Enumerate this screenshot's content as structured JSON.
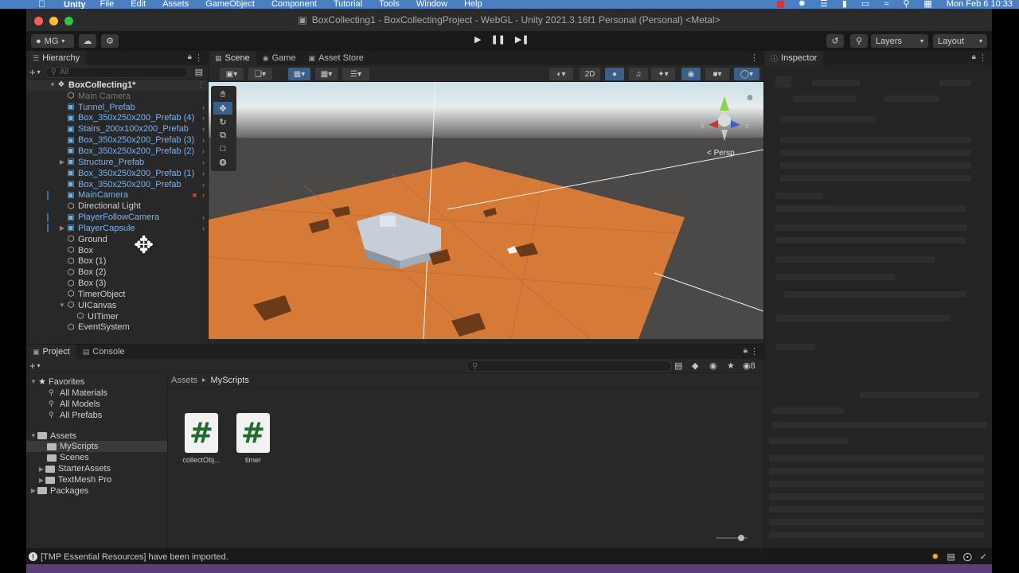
{
  "menubar": {
    "app": "Unity",
    "items": [
      "File",
      "Edit",
      "Assets",
      "GameObject",
      "Component",
      "Tutorial",
      "Tools",
      "Window",
      "Help"
    ],
    "clock": "Mon Feb 6  10:33"
  },
  "window": {
    "title": "BoxCollecting1 - BoxCollectingProject - WebGL - Unity 2021.3.16f1 Personal (Personal) <Metal>"
  },
  "toolbar": {
    "account": "MG",
    "layers": "Layers",
    "layout": "Layout"
  },
  "hierarchy": {
    "tab": "Hierarchy",
    "search_placeholder": "All",
    "scene": "BoxCollecting1*",
    "items": [
      {
        "name": "Main Camera",
        "style": "dim",
        "icon": "white"
      },
      {
        "name": "Tunnel_Prefab",
        "style": "prefab",
        "icon": "blue"
      },
      {
        "name": "Box_350x250x200_Prefab (4)",
        "style": "prefab",
        "icon": "blue"
      },
      {
        "name": "Stairs_200x100x200_Prefab",
        "style": "prefab",
        "icon": "blue"
      },
      {
        "name": "Box_350x250x200_Prefab (3)",
        "style": "prefab",
        "icon": "blue"
      },
      {
        "name": "Box_350x250x200_Prefab (2)",
        "style": "prefab",
        "icon": "blue"
      },
      {
        "name": "Structure_Prefab",
        "style": "prefab",
        "icon": "blue"
      },
      {
        "name": "Box_350x250x200_Prefab (1)",
        "style": "prefab",
        "icon": "blue"
      },
      {
        "name": "Box_350x250x200_Prefab",
        "style": "prefab",
        "icon": "blue"
      },
      {
        "name": "MainCamera",
        "style": "prefab",
        "icon": "blue"
      },
      {
        "name": "Directional Light",
        "style": "plain",
        "icon": "white"
      },
      {
        "name": "PlayerFollowCamera",
        "style": "prefab",
        "icon": "blue"
      },
      {
        "name": "PlayerCapsule",
        "style": "prefab",
        "icon": "blue"
      },
      {
        "name": "Ground",
        "style": "plain",
        "icon": "white"
      },
      {
        "name": "Box",
        "style": "plain",
        "icon": "white"
      },
      {
        "name": "Box (1)",
        "style": "plain",
        "icon": "white"
      },
      {
        "name": "Box (2)",
        "style": "plain",
        "icon": "white"
      },
      {
        "name": "Box (3)",
        "style": "plain",
        "icon": "white"
      },
      {
        "name": "TimerObject",
        "style": "plain",
        "icon": "white"
      },
      {
        "name": "UICanvas",
        "style": "plain",
        "icon": "white"
      },
      {
        "name": "UITimer",
        "style": "plain",
        "icon": "white"
      },
      {
        "name": "EventSystem",
        "style": "plain",
        "icon": "white"
      }
    ]
  },
  "scene_view": {
    "tabs": [
      "Scene",
      "Game",
      "Asset Store"
    ],
    "mode_2d": "2D",
    "persp": "< Persp"
  },
  "inspector": {
    "tab": "Inspector"
  },
  "project": {
    "tabs": [
      "Project",
      "Console"
    ],
    "favorites_label": "Favorites",
    "favorites": [
      "All Materials",
      "All Models",
      "All Prefabs"
    ],
    "assets_label": "Assets",
    "folders": [
      "MyScripts",
      "Scenes",
      "StarterAssets",
      "TextMesh Pro"
    ],
    "packages_label": "Packages",
    "breadcrumb_root": "Assets",
    "breadcrumb_current": "MyScripts",
    "hidden_count": "8",
    "files": [
      {
        "glyph": "#",
        "label": "collectObj..."
      },
      {
        "glyph": "#",
        "label": "timer"
      }
    ]
  },
  "status": {
    "message": "[TMP Essential Resources] have been imported."
  },
  "colors": {
    "accent": "#3c5f8a",
    "prefab_text": "#7cb2ec",
    "ground": "#d97a3a",
    "sky": "#e7eef0"
  }
}
